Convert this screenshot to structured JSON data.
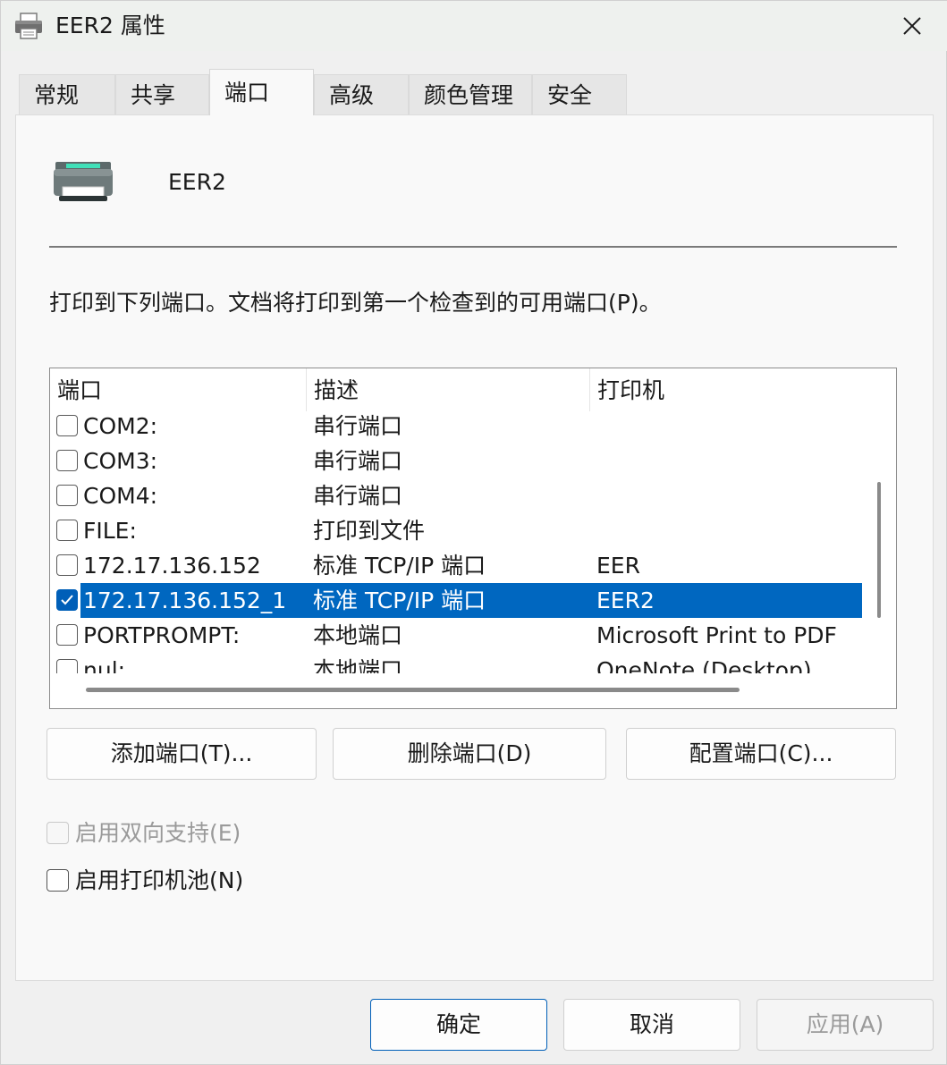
{
  "window": {
    "title": "EER2 属性",
    "printer_icon": "printer-icon",
    "close_icon": "close-icon"
  },
  "tabs": [
    {
      "label": "常规",
      "active": false
    },
    {
      "label": "共享",
      "active": false
    },
    {
      "label": "端口",
      "active": true
    },
    {
      "label": "高级",
      "active": false
    },
    {
      "label": "颜色管理",
      "active": false
    },
    {
      "label": "安全",
      "active": false
    }
  ],
  "header": {
    "printer_name": "EER2",
    "description": "打印到下列端口。文档将打印到第一个检查到的可用端口(P)。"
  },
  "ports_table": {
    "columns": [
      "端口",
      "描述",
      "打印机"
    ],
    "rows": [
      {
        "port": "COM2:",
        "description": "串行端口",
        "printer": "",
        "checked": false,
        "selected": false
      },
      {
        "port": "COM3:",
        "description": "串行端口",
        "printer": "",
        "checked": false,
        "selected": false
      },
      {
        "port": "COM4:",
        "description": "串行端口",
        "printer": "",
        "checked": false,
        "selected": false
      },
      {
        "port": "FILE:",
        "description": "打印到文件",
        "printer": "",
        "checked": false,
        "selected": false
      },
      {
        "port": "172.17.136.152",
        "description": "标准 TCP/IP 端口",
        "printer": "EER",
        "checked": false,
        "selected": false
      },
      {
        "port": "172.17.136.152_1",
        "description": "标准 TCP/IP 端口",
        "printer": "EER2",
        "checked": true,
        "selected": true
      },
      {
        "port": "PORTPROMPT:",
        "description": "本地端口",
        "printer": "Microsoft Print to PDF",
        "checked": false,
        "selected": false
      },
      {
        "port": "nul:",
        "description": "本地端口",
        "printer": "OneNote (Desktop)",
        "checked": false,
        "selected": false
      }
    ]
  },
  "port_buttons": {
    "add": "添加端口(T)...",
    "delete": "删除端口(D)",
    "configure": "配置端口(C)..."
  },
  "options": {
    "bidirectional": {
      "label": "启用双向支持(E)",
      "checked": false,
      "enabled": false
    },
    "pooling": {
      "label": "启用打印机池(N)",
      "checked": false,
      "enabled": true
    }
  },
  "dialog_buttons": {
    "ok": "确定",
    "cancel": "取消",
    "apply": "应用(A)"
  },
  "colors": {
    "selection": "#0067c0",
    "accent": "#005fb8"
  }
}
